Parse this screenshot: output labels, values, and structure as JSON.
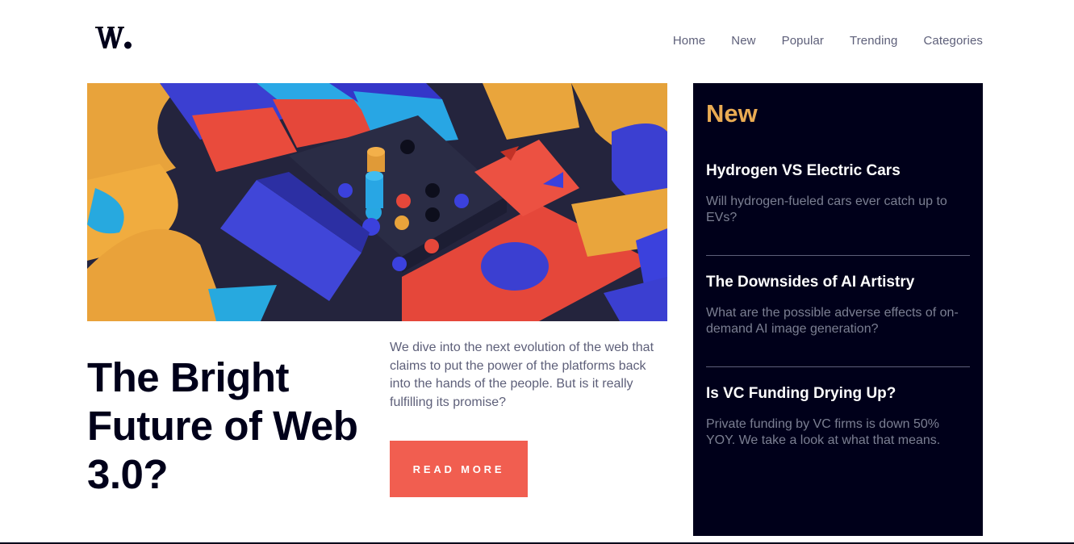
{
  "brand": {
    "logo_text": "W."
  },
  "nav": {
    "items": [
      {
        "label": "Home"
      },
      {
        "label": "New"
      },
      {
        "label": "Popular"
      },
      {
        "label": "Trending"
      },
      {
        "label": "Categories"
      }
    ]
  },
  "hero": {
    "image_icon": "abstract-blocks-image",
    "title": "The Bright Future of Web 3.0?",
    "blurb": "We dive into the next evolution of the web that claims to put the power of the platforms back into the hands of the people. But is it really fulfilling its promise?",
    "cta_label": "READ MORE"
  },
  "aside": {
    "title": "New",
    "items": [
      {
        "title": "Hydrogen VS Electric Cars",
        "desc": "Will hydrogen-fueled cars ever catch up to EVs?"
      },
      {
        "title": "The Downsides of AI Artistry",
        "desc": "What are the possible adverse effects of on-demand AI image generation?"
      },
      {
        "title": "Is VC Funding Drying Up?",
        "desc": "Private funding by VC firms is down 50% YOY. We take a look at what that means."
      }
    ]
  },
  "colors": {
    "dark": "#00001a",
    "accent": "#f15e50",
    "aside_title": "#e9ab53",
    "muted": "#5d5f79"
  }
}
